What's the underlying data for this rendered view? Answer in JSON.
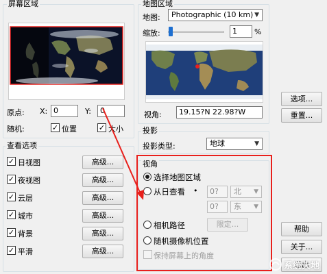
{
  "screen_area": {
    "title": "屏幕区域",
    "origin_label": "原点:",
    "x_label": "X:",
    "x_value": "0",
    "y_label": "Y:",
    "y_value": "0",
    "random_label": "随机:",
    "position_checkbox": "位置",
    "size_checkbox": "大小"
  },
  "map_area": {
    "title": "地图区域",
    "map_label": "地图:",
    "map_value": "Photographic (10 km)",
    "zoom_label": "缩放:",
    "zoom_value": "1",
    "zoom_unit": "%",
    "view_label": "视角:",
    "view_value": "19.15?N   22.98?W"
  },
  "projection": {
    "title": "投影",
    "type_label": "投影类型:",
    "type_value": "地球"
  },
  "view_options": {
    "title": "查看选项",
    "advanced_label": "高级...",
    "items": [
      {
        "label": "日视图",
        "checked": true
      },
      {
        "label": "夜视图",
        "checked": true
      },
      {
        "label": "云层",
        "checked": true
      },
      {
        "label": "城市",
        "checked": true
      },
      {
        "label": "背景",
        "checked": true
      },
      {
        "label": "平滑",
        "checked": true
      }
    ]
  },
  "viewpoint": {
    "title": "视角",
    "select_map_area": "选择地图区域",
    "view_from_sun": "从日查看",
    "lat_value": "0?",
    "lat_dir": "北",
    "lon_value": "0?",
    "lon_dir": "东",
    "camera_path": "相机路径",
    "limit_button": "限定...",
    "random_camera": "随机摄像机位置",
    "keep_angle": "保持屏幕上的角度"
  },
  "buttons": {
    "options": "选项...",
    "reset": "重置...",
    "help": "帮助",
    "about": "关于...",
    "exit": "退出"
  },
  "watermark": "系统天地",
  "colors": {
    "highlight_red": "#e8201c",
    "ocean_dark": "#12223f",
    "accent_blue": "#1e6fd0"
  }
}
